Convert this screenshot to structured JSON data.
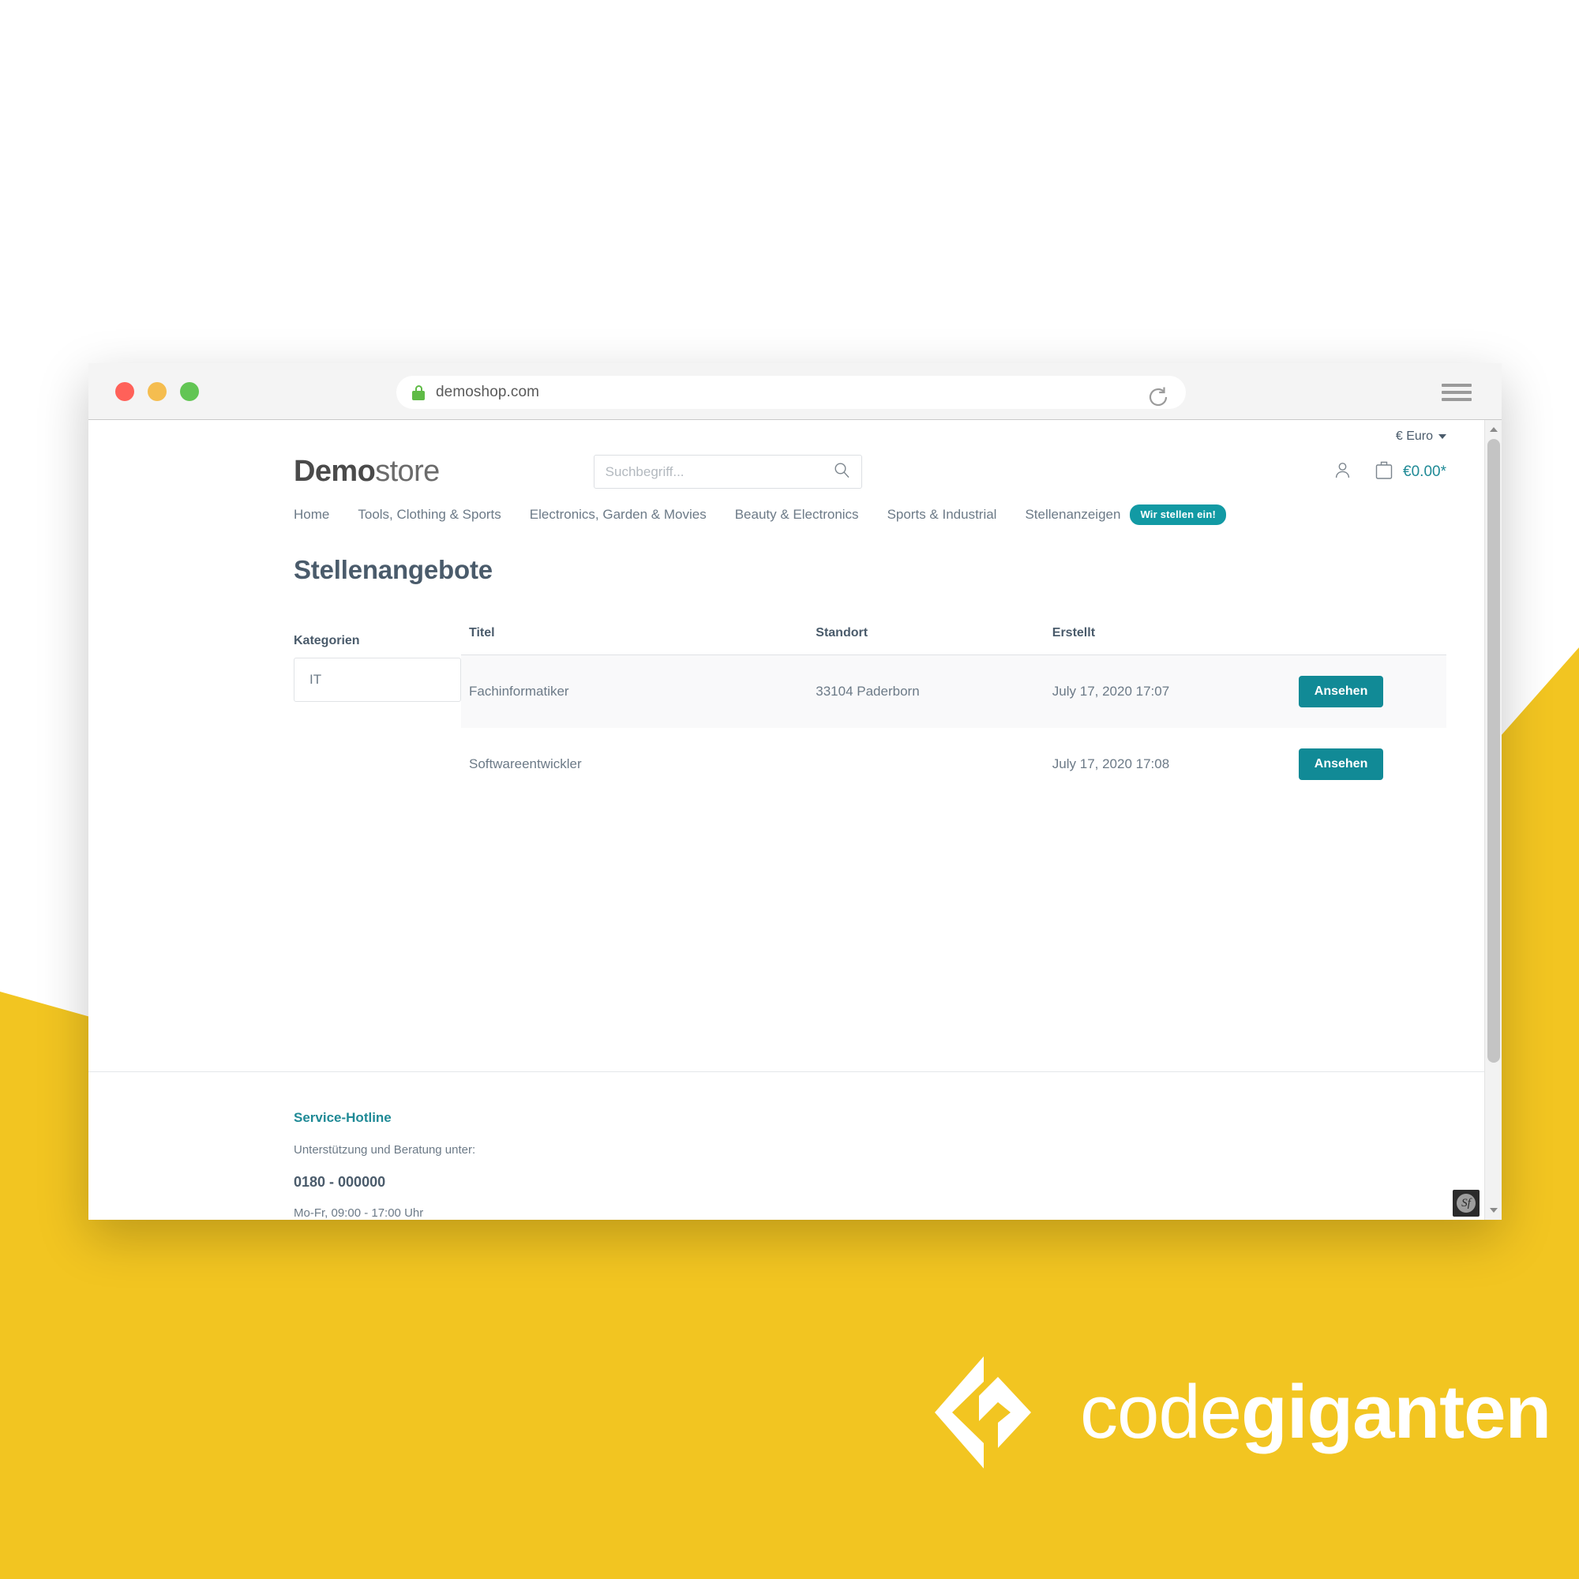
{
  "browser": {
    "url": "demoshop.com",
    "lock_icon": "lock-icon",
    "reload_icon": "reload-icon",
    "menu_icon": "hamburger-menu-icon",
    "traffic_lights": [
      "close",
      "minimize",
      "maximize"
    ]
  },
  "shop": {
    "currency": "€ Euro",
    "logo_bold": "Demo",
    "logo_light": "store",
    "search": {
      "placeholder": "Suchbegriff...",
      "value": "",
      "icon": "search-icon"
    },
    "account_icon": "user-account-icon",
    "cart_icon": "shopping-bag-icon",
    "cart_total": "€0.00*",
    "nav": [
      {
        "label": "Home",
        "badge": null
      },
      {
        "label": "Tools, Clothing & Sports",
        "badge": null
      },
      {
        "label": "Electronics, Garden & Movies",
        "badge": null
      },
      {
        "label": "Beauty & Electronics",
        "badge": null
      },
      {
        "label": "Sports & Industrial",
        "badge": null
      },
      {
        "label": "Stellenanzeigen",
        "badge": "Wir stellen ein!"
      }
    ]
  },
  "main": {
    "title": "Stellenangebote",
    "sidebar": {
      "label": "Kategorien",
      "category_value": "IT"
    },
    "table": {
      "headers": [
        "Titel",
        "Standort",
        "Erstellt",
        ""
      ],
      "rows": [
        {
          "titel": "Fachinformatiker",
          "standort": "33104 Paderborn",
          "erstellt": "July 17, 2020 17:07",
          "action": "Ansehen"
        },
        {
          "titel": "Softwareentwickler",
          "standort": "",
          "erstellt": "July 17, 2020 17:08",
          "action": "Ansehen"
        }
      ]
    }
  },
  "footer": {
    "heading": "Service-Hotline",
    "subtitle": "Unterstützung und Beratung unter:",
    "phone": "0180 - 000000",
    "hours": "Mo-Fr, 09:00 - 17:00 Uhr",
    "debug_badge": "Sf"
  },
  "branding": {
    "logo_thin": "code",
    "logo_bold": "giganten",
    "accent_yellow": "#f2c521",
    "accent_teal": "#129aa4"
  }
}
